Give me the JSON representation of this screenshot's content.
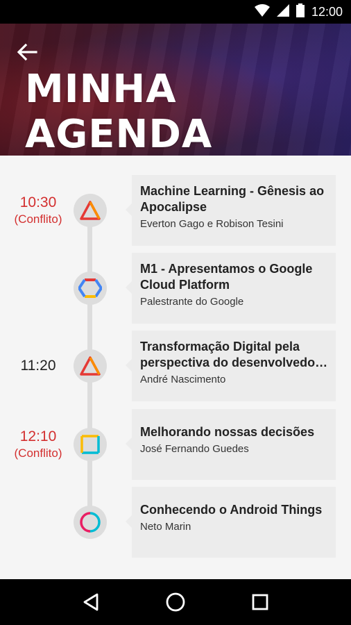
{
  "status_bar": {
    "time": "12:00"
  },
  "header": {
    "title": "MINHA AGENDA"
  },
  "agenda": {
    "items": [
      {
        "time": "10:30",
        "conflict": "(Conflito)",
        "title": "Machine Learning - Gênesis ao Apocalipse",
        "speaker": "Everton Gago e Robison Tesini",
        "icon": "triangle-icon"
      },
      {
        "time": "",
        "conflict": "",
        "title": "M1 - Apresentamos o Google Cloud Platform",
        "speaker": "Palestrante do Google",
        "icon": "hexagon-icon"
      },
      {
        "time": "11:20",
        "conflict": "",
        "title_line1": "Transformação Digital pela",
        "title_line2": "perspectiva do desenvolvedo…",
        "speaker": "André Nascimento",
        "icon": "triangle-icon"
      },
      {
        "time": "12:10",
        "conflict": "(Conflito)",
        "title": "Melhorando nossas decisões",
        "speaker": "José Fernando Guedes",
        "icon": "square-icon"
      },
      {
        "time": "",
        "conflict": "",
        "title": "Conhecendo o Android Things",
        "speaker": "Neto Marin",
        "icon": "circle-icon"
      }
    ]
  },
  "colors": {
    "conflict": "#d32f2f",
    "card": "#ececec",
    "node": "#dddddd"
  }
}
